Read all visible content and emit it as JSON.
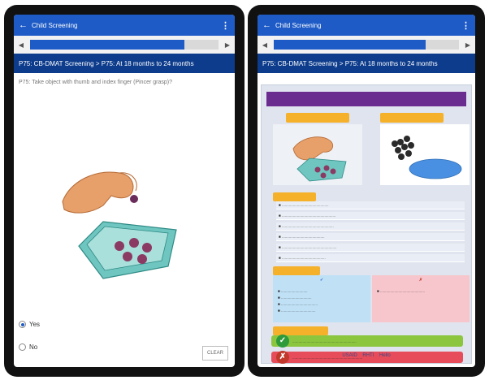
{
  "left_app": {
    "appbar_title": "Child Screening",
    "section_title": "P75: CB-DMAT Screening > P75: At 18 months to 24 months",
    "question": "P75: Take object with thumb and index finger (Pincer grasp)?",
    "progress_fraction": 0.82,
    "options": [
      {
        "label": "Yes",
        "selected": true
      },
      {
        "label": "No",
        "selected": false
      }
    ],
    "clear_label": "CLEAR"
  },
  "right_app": {
    "appbar_title": "Child Screening",
    "section_title": "P75: CB-DMAT Screening > P75: At 18 months to 24 months",
    "progress_fraction": 0.82,
    "logos": [
      "USAID",
      "RHTI",
      "Hello"
    ]
  },
  "colors": {
    "appbar": "#1e5bc6",
    "section": "#0d3c8c",
    "poster_header": "#6a2c8e",
    "tag": "#f5b12a",
    "yes_bar": "#8cc63f",
    "no_bar": "#e74c5a",
    "can_box": "#bfe0f5",
    "cannot_box": "#f7c6cc"
  },
  "icons": {
    "back": "back-arrow-icon",
    "menu": "more-vert-icon",
    "prev": "chevron-left-icon",
    "next": "chevron-right-icon",
    "check": "check-icon",
    "cross": "cross-icon"
  }
}
